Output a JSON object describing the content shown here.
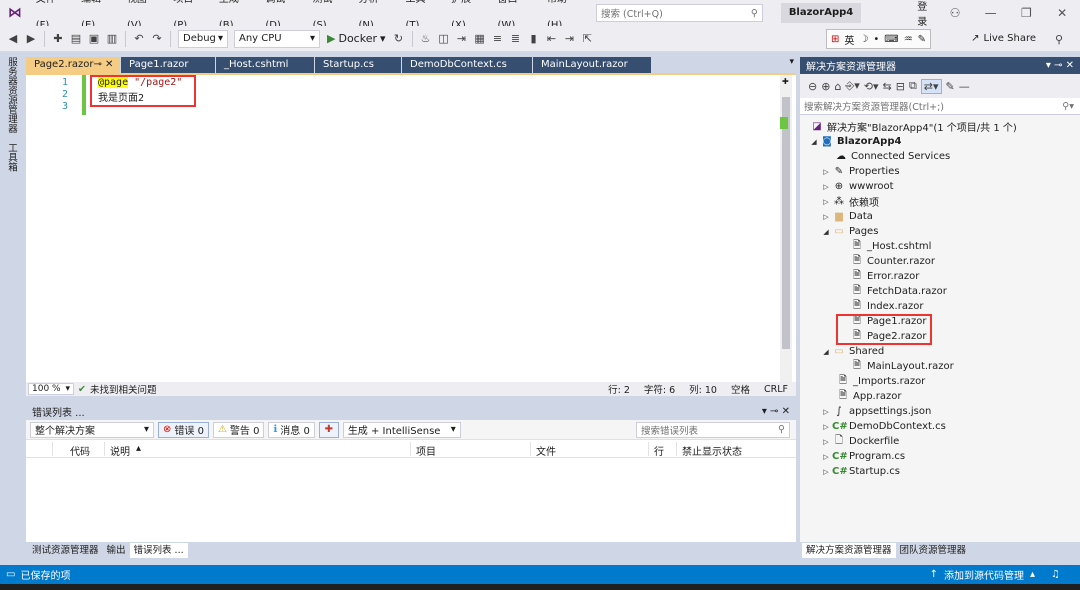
{
  "menubar": {
    "items": [
      "文件(F)",
      "编辑(E)",
      "视图(V)",
      "项目(P)",
      "生成(B)",
      "调试(D)",
      "测试(S)",
      "分析(N)",
      "工具(T)",
      "扩展(X)",
      "窗口(W)",
      "帮助(H)"
    ],
    "search_placeholder": "搜索 (Ctrl+Q)",
    "app_title": "BlazorApp4",
    "login": "登录"
  },
  "toolbar": {
    "config": "Debug",
    "platform": "Any CPU",
    "run_target": "Docker",
    "live_share": "Live Share",
    "ime_mode": "英"
  },
  "left_strip": {
    "server_explorer": "服务器资源管理器",
    "toolbox": "工具箱"
  },
  "doc_tabs": [
    "Page2.razor",
    "Page1.razor",
    "_Host.cshtml",
    "Startup.cs",
    "DemoDbContext.cs",
    "MainLayout.razor"
  ],
  "editor": {
    "line_numbers": [
      "1",
      "2",
      "3"
    ],
    "line1_keyword": "@page",
    "line1_string": "\"/page2\"",
    "line2_text": "我是页面2"
  },
  "editor_status": {
    "zoom": "100 %",
    "issues": "未找到相关问题",
    "row": "行: 2",
    "char": "字符: 6",
    "col": "列: 10",
    "space": "空格",
    "eol": "CRLF"
  },
  "error_list": {
    "title": "错误列表 ...",
    "scope": "整个解决方案",
    "errors": "错误 0",
    "warnings": "警告 0",
    "messages": "消息 0",
    "build_mode": "生成 + IntelliSense",
    "search_placeholder": "搜索错误列表",
    "columns": [
      "代码",
      "说明",
      "项目",
      "文件",
      "行",
      "禁止显示状态"
    ]
  },
  "bottom_tabs": [
    "测试资源管理器",
    "输出",
    "错误列表 ..."
  ],
  "solution_explorer": {
    "title": "解决方案资源管理器",
    "search_placeholder": "搜索解决方案资源管理器(Ctrl+;)",
    "solution": "解决方案\"BlazorApp4\"(1 个项目/共 1 个)",
    "project": "BlazorApp4",
    "items": {
      "connected": "Connected Services",
      "properties": "Properties",
      "wwwroot": "wwwroot",
      "deps": "依赖项",
      "data": "Data",
      "pages": "Pages",
      "host": "_Host.cshtml",
      "counter": "Counter.razor",
      "error": "Error.razor",
      "fetch": "FetchData.razor",
      "index": "Index.razor",
      "page1": "Page1.razor",
      "page2": "Page2.razor",
      "shared": "Shared",
      "mainlayout": "MainLayout.razor",
      "imports": "_Imports.razor",
      "app": "App.razor",
      "appsettings": "appsettings.json",
      "dbcontext": "DemoDbContext.cs",
      "dockerfile": "Dockerfile",
      "program": "Program.cs",
      "startup": "Startup.cs"
    },
    "bottom_tabs": [
      "解决方案资源管理器",
      "团队资源管理器"
    ]
  },
  "statusbar": {
    "left": "已保存的项",
    "right": "添加到源代码管理"
  }
}
